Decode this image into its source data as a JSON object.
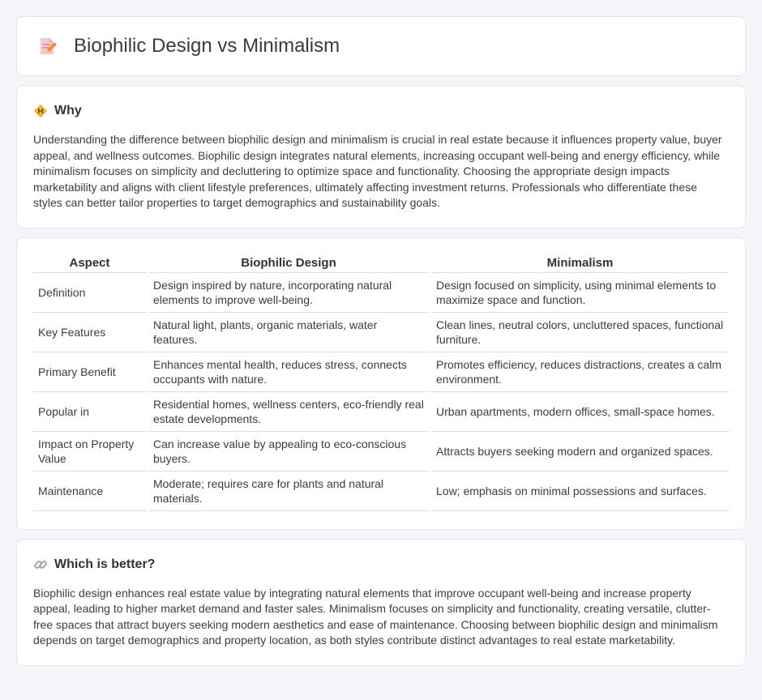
{
  "header": {
    "title": "Biophilic Design vs Minimalism",
    "icon": "document-pencil-icon"
  },
  "why": {
    "title": "Why",
    "icon": "diamond-sign-icon",
    "text": "Understanding the difference between biophilic design and minimalism is crucial in real estate because it influences property value, buyer appeal, and wellness outcomes. Biophilic design integrates natural elements, increasing occupant well-being and energy efficiency, while minimalism focuses on simplicity and decluttering to optimize space and functionality. Choosing the appropriate design impacts marketability and aligns with client lifestyle preferences, ultimately affecting investment returns. Professionals who differentiate these styles can better tailor properties to target demographics and sustainability goals."
  },
  "table": {
    "headers": [
      "Aspect",
      "Biophilic Design",
      "Minimalism"
    ],
    "rows": [
      [
        "Definition",
        "Design inspired by nature, incorporating natural elements to improve well-being.",
        "Design focused on simplicity, using minimal elements to maximize space and function."
      ],
      [
        "Key Features",
        "Natural light, plants, organic materials, water features.",
        "Clean lines, neutral colors, uncluttered spaces, functional furniture."
      ],
      [
        "Primary Benefit",
        "Enhances mental health, reduces stress, connects occupants with nature.",
        "Promotes efficiency, reduces distractions, creates a calm environment."
      ],
      [
        "Popular in",
        "Residential homes, wellness centers, eco-friendly real estate developments.",
        "Urban apartments, modern offices, small-space homes."
      ],
      [
        "Impact on Property Value",
        "Can increase value by appealing to eco-conscious buyers.",
        "Attracts buyers seeking modern and organized spaces."
      ],
      [
        "Maintenance",
        "Moderate; requires care for plants and natural materials.",
        "Low; emphasis on minimal possessions and surfaces."
      ]
    ]
  },
  "better": {
    "title": "Which is better?",
    "icon": "link-icon",
    "text": "Biophilic design enhances real estate value by integrating natural elements that improve occupant well-being and increase property appeal, leading to higher market demand and faster sales. Minimalism focuses on simplicity and functionality, creating versatile, clutter-free spaces that attract buyers seeking modern aesthetics and ease of maintenance. Choosing between biophilic design and minimalism depends on target demographics and property location, as both styles contribute distinct advantages to real estate marketability."
  }
}
